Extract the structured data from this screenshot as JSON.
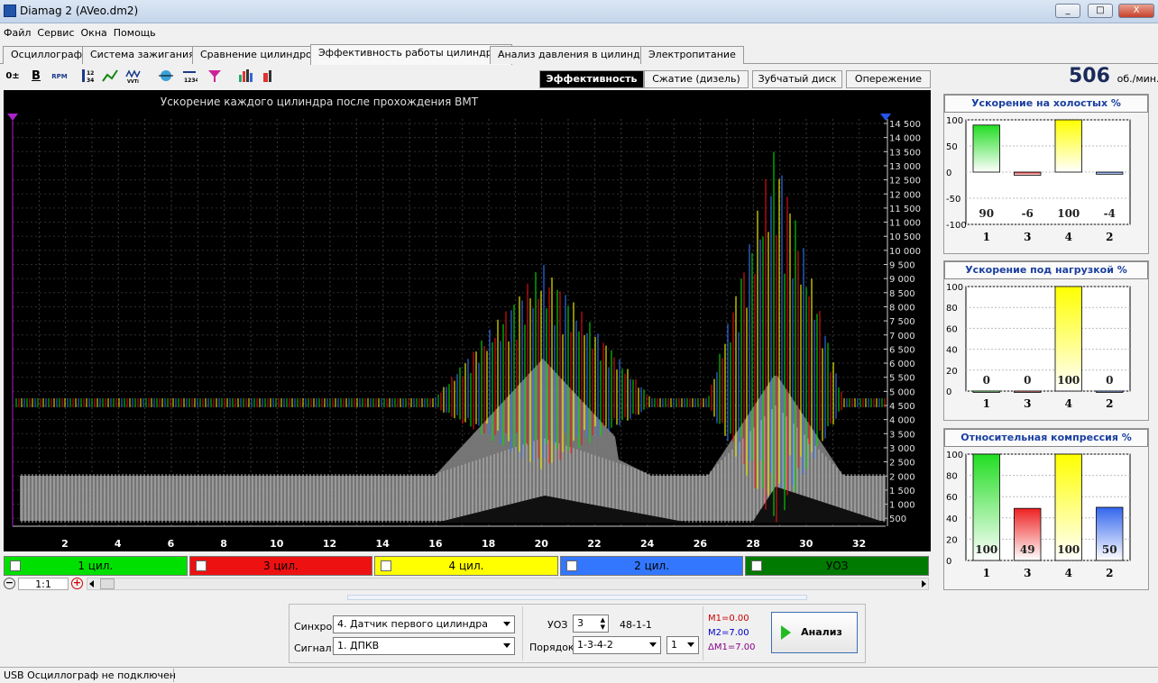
{
  "window": {
    "title": "Diamag 2 (AVeo.dm2)",
    "min": "_",
    "max": "□",
    "close": "X"
  },
  "menu": [
    "Файл",
    "Сервис",
    "Окна",
    "Помощь"
  ],
  "tabs": [
    "Осциллограф",
    "Система зажигания",
    "Сравнение цилиндров",
    "Эффективность работы цилиндров",
    "Анализ давления в цилиндре",
    "Электропитание"
  ],
  "toolbar": {
    "b1": "0±",
    "b2": "B",
    "b3": "RPM"
  },
  "subtabs": [
    "Эффективность",
    "Сжатие (дизель)",
    "Зубчатый диск",
    "Опережение"
  ],
  "rpm": {
    "value": "506",
    "unit": "об./мин."
  },
  "plot": {
    "title": "Ускорение каждого цилиндра после прохождения ВМТ",
    "xticks": [
      "2",
      "4",
      "6",
      "8",
      "10",
      "12",
      "14",
      "16",
      "18",
      "20",
      "22",
      "24",
      "26",
      "28",
      "30",
      "32"
    ],
    "yticks": [
      "14 500",
      "14 000",
      "13 500",
      "13 000",
      "12 500",
      "12 000",
      "11 500",
      "11 000",
      "10 500",
      "10 000",
      "9 500",
      "9 000",
      "8 500",
      "8 000",
      "7 500",
      "7 000",
      "6 500",
      "6 000",
      "5 500",
      "5 000",
      "4 500",
      "4 000",
      "3 500",
      "3 000",
      "2 500",
      "2 000",
      "1 500",
      "1 000",
      "500"
    ]
  },
  "legend": [
    {
      "label": "1 цил.",
      "color": "#00e000"
    },
    {
      "label": "3 цил.",
      "color": "#ee1111"
    },
    {
      "label": "4 цил.",
      "color": "#ffff00"
    },
    {
      "label": "2 цил.",
      "color": "#3377ff"
    },
    {
      "label": "УОЗ",
      "color": "#007a00"
    }
  ],
  "zoom": "1:1",
  "panels": [
    {
      "title": "Ускорение на холостых %",
      "yticks": [
        "100",
        "50",
        "0",
        "-50",
        "-100"
      ],
      "ylim": [
        -100,
        100
      ],
      "bars": [
        {
          "cyl": "1",
          "value": "90",
          "color": "#22dd22"
        },
        {
          "cyl": "3",
          "value": "-6",
          "color": "#dd2222"
        },
        {
          "cyl": "4",
          "value": "100",
          "color": "#ffff00"
        },
        {
          "cyl": "2",
          "value": "-4",
          "color": "#3366ee"
        }
      ]
    },
    {
      "title": "Ускорение под нагрузкой %",
      "yticks": [
        "100",
        "80",
        "60",
        "40",
        "20",
        "0"
      ],
      "ylim": [
        0,
        100
      ],
      "bars": [
        {
          "cyl": "1",
          "value": "0",
          "color": "#22dd22"
        },
        {
          "cyl": "3",
          "value": "0",
          "color": "#dd2222"
        },
        {
          "cyl": "4",
          "value": "100",
          "color": "#ffff00"
        },
        {
          "cyl": "2",
          "value": "0",
          "color": "#3366ee"
        }
      ]
    },
    {
      "title": "Относительная компрессия %",
      "yticks": [
        "100",
        "80",
        "60",
        "40",
        "20",
        "0"
      ],
      "ylim": [
        0,
        100
      ],
      "bars": [
        {
          "cyl": "1",
          "value": "100",
          "color": "#22dd22"
        },
        {
          "cyl": "3",
          "value": "49",
          "color": "#ee2222"
        },
        {
          "cyl": "4",
          "value": "100",
          "color": "#ffff00"
        },
        {
          "cyl": "2",
          "value": "50",
          "color": "#3366ee"
        }
      ]
    }
  ],
  "controls": {
    "sync_label": "Синхро:",
    "sync_value": "4. Датчик первого цилиндра",
    "signal_label": "Сигнал:",
    "signal_value": "1. ДПКВ",
    "uoz_label": "УОЗ",
    "uoz_value": "3",
    "gear": "48-1-1",
    "order_label": "Порядок",
    "order_value": "1-3-4-2",
    "order_num": "1",
    "m1": "M1=0.00",
    "m2": "M2=7.00",
    "dm1": "ΔM1=7.00",
    "analyze": "Анализ"
  },
  "status": "USB Осциллограф не подключен",
  "chart_data": [
    {
      "type": "bar",
      "title": "Ускорение на холостых %",
      "categories": [
        "1",
        "3",
        "4",
        "2"
      ],
      "values": [
        90,
        -6,
        100,
        -4
      ],
      "ylim": [
        -100,
        100
      ]
    },
    {
      "type": "bar",
      "title": "Ускорение под нагрузкой %",
      "categories": [
        "1",
        "3",
        "4",
        "2"
      ],
      "values": [
        0,
        0,
        100,
        0
      ],
      "ylim": [
        0,
        100
      ]
    },
    {
      "type": "bar",
      "title": "Относительная компрессия %",
      "categories": [
        "1",
        "3",
        "4",
        "2"
      ],
      "values": [
        100,
        49,
        100,
        50
      ],
      "ylim": [
        0,
        100
      ]
    }
  ]
}
